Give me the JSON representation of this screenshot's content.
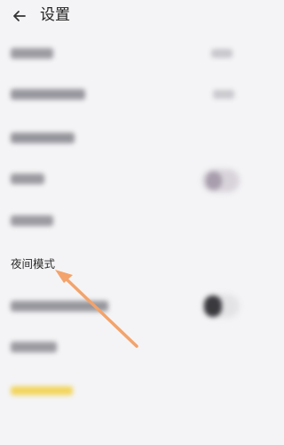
{
  "header": {
    "back_icon": "arrow-left-icon",
    "title": "设置"
  },
  "rows": {
    "night_mode_label": "夜间模式"
  },
  "colors": {
    "background": "#f4f4f6",
    "annotation_arrow": "#f3a36b",
    "blurred_accent": "#f2d45a"
  }
}
